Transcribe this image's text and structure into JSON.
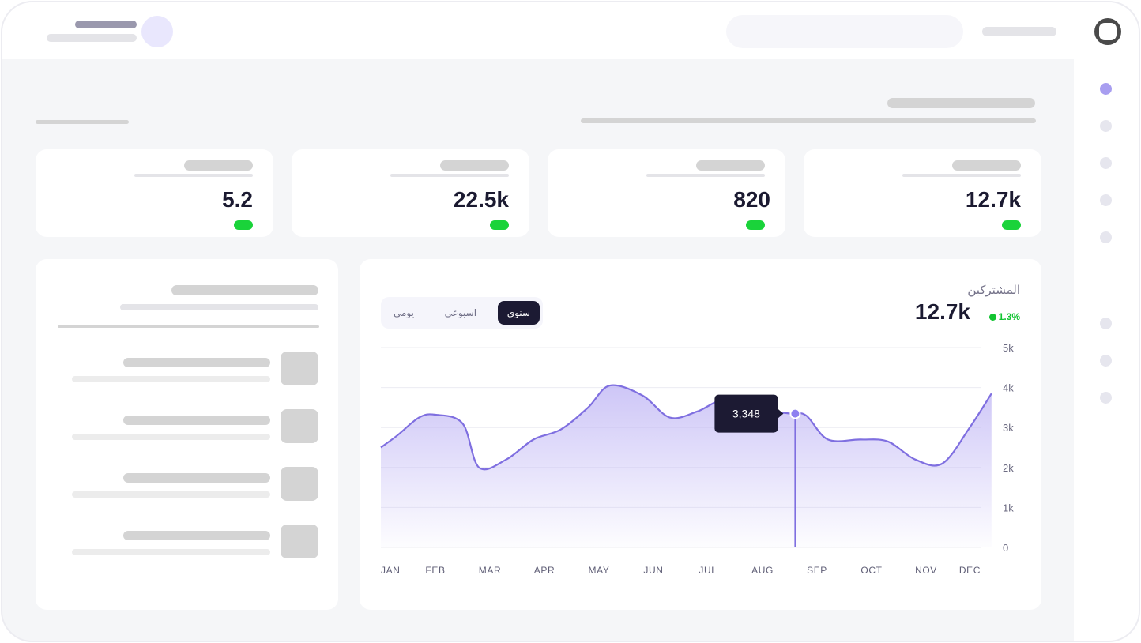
{
  "topbar": {
    "logo_icon": "logo-circle-icon",
    "avatar_icon": "user-avatar-icon"
  },
  "sidebar": {
    "items": [
      {
        "icon": "nav-dot-icon",
        "active": true
      },
      {
        "icon": "nav-dot-icon",
        "active": false
      },
      {
        "icon": "nav-dot-icon",
        "active": false
      },
      {
        "icon": "nav-dot-icon",
        "active": false
      },
      {
        "icon": "nav-dot-icon",
        "active": false
      },
      {
        "icon": "nav-dot-icon",
        "active": false
      },
      {
        "icon": "nav-dot-icon",
        "active": false
      },
      {
        "icon": "nav-dot-icon",
        "active": false
      }
    ]
  },
  "stats": [
    {
      "value": "12.7k"
    },
    {
      "value": "820"
    },
    {
      "value": "22.5k"
    },
    {
      "value": "5.2"
    }
  ],
  "chart": {
    "title": "المشتركين",
    "total": "12.7k",
    "delta": "1.3%",
    "tabs": [
      "سنوي",
      "اسبوعي",
      "يومي"
    ],
    "active_tab": 0,
    "tooltip": "3,348"
  },
  "colors": {
    "accent": "#7f6fe0",
    "positive": "#12c431",
    "dark": "#1c1a33"
  },
  "chart_data": {
    "type": "area",
    "categories": [
      "JAN",
      "FEB",
      "MAR",
      "APR",
      "MAY",
      "JUN",
      "JUL",
      "AUG",
      "SEP",
      "OCT",
      "NOV",
      "DEC"
    ],
    "x": [
      0,
      0.3,
      0.7,
      1.0,
      1.5,
      1.8,
      2.3,
      2.8,
      3.3,
      3.8,
      4.2,
      4.8,
      5.3,
      5.8,
      6.3,
      6.8,
      7.5,
      7.8,
      8.2,
      8.8,
      9.3,
      9.8,
      10.3,
      10.8,
      11.2
    ],
    "y": [
      2500,
      2800,
      3250,
      3320,
      3100,
      2000,
      2200,
      2700,
      2950,
      3500,
      4050,
      3800,
      3250,
      3400,
      3700,
      3470,
      3350,
      3300,
      2700,
      2700,
      2650,
      2200,
      2100,
      3000,
      3850
    ],
    "ylim": [
      0,
      5000
    ],
    "yticks": [
      "0",
      "1k",
      "2k",
      "3k",
      "4k",
      "5k"
    ],
    "highlight": {
      "x": 7.6,
      "y": 3348,
      "label": "3,348"
    },
    "grid": true
  }
}
